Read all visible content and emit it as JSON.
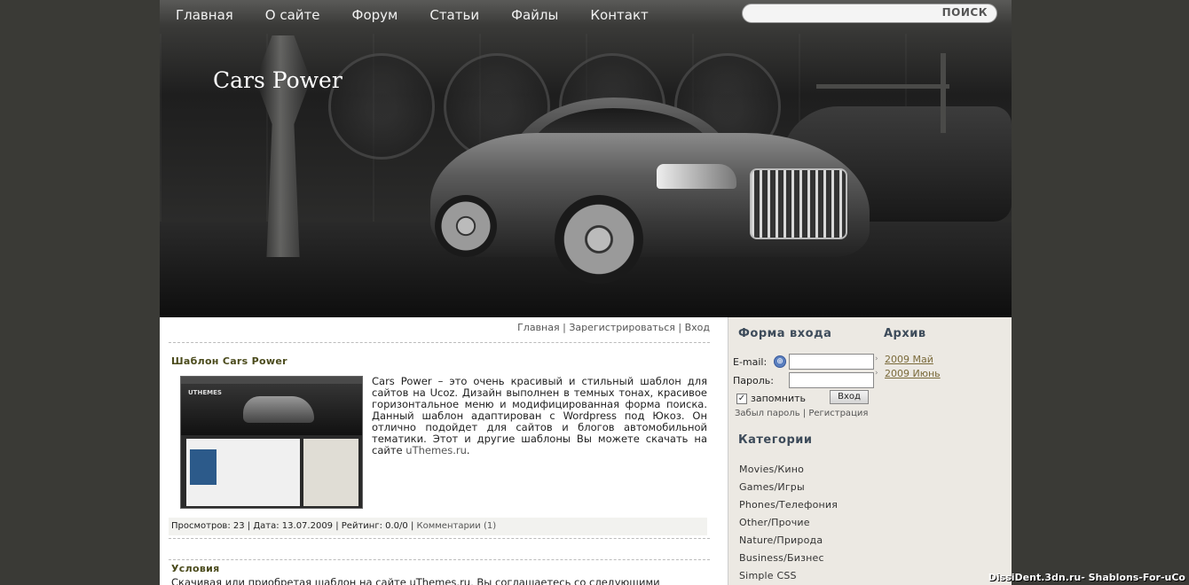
{
  "nav": {
    "items": [
      "Главная",
      "О сайте",
      "Форум",
      "Статьи",
      "Файлы",
      "Контакт"
    ]
  },
  "search": {
    "button_label": "ПОИСК",
    "value": ""
  },
  "site": {
    "title": "Cars Power"
  },
  "toplinks": {
    "home": "Главная",
    "register": "Зарегистрироваться",
    "login": "Вход",
    "separator": "|"
  },
  "post": {
    "title": "Шаблон Cars Power",
    "thumb_brand": "UTHEMES",
    "text": "Cars Power – это очень красивый и стильный шаблон для сайтов на Ucoz. Дизайн выполнен в темных тонах, красивое горизонтальное меню и модифицированная форма поиска. Данный шаблон адаптирован с Wordpress под Юкоз. Он отлично подойдет для сайтов и блогов автомобильной тематики. Этот и другие шаблоны Вы можете скачать на сайте ",
    "link": "uThemes.ru",
    "text_end": ".",
    "meta_views": "Просмотров: 23",
    "meta_date": "Дата: 13.07.2009",
    "meta_rating": "Рейтинг: 0.0/0",
    "meta_comments": "Комментарии (1)"
  },
  "post2": {
    "title": "Условия",
    "text": "Скачивая или приобретая шаблон на сайте uThemes.ru, Вы соглашаетесь со следующими"
  },
  "login_form": {
    "heading": "Форма входа",
    "email_label": "E-mail:",
    "password_label": "Пароль:",
    "remember_label": "запомнить",
    "button": "Вход",
    "forgot": "Забыл пароль",
    "register": "Регистрация"
  },
  "archive": {
    "heading": "Архив",
    "items": [
      "2009 Май",
      "2009 Июнь"
    ]
  },
  "categories": {
    "heading": "Категории",
    "items": [
      "Movies/Кино",
      "Games/Игры",
      "Phones/Телефония",
      "Other/Прочие",
      "Nature/Природа",
      "Business/Бизнес",
      "Simple CSS"
    ]
  },
  "watermark": "DissiDent.3dn.ru- Shablons-For-uCo",
  "colors": {
    "background": "#3a3a36",
    "sidebar": "#ece9e3",
    "post_title": "#4b4b1c",
    "archive_link": "#7a6a3a"
  }
}
